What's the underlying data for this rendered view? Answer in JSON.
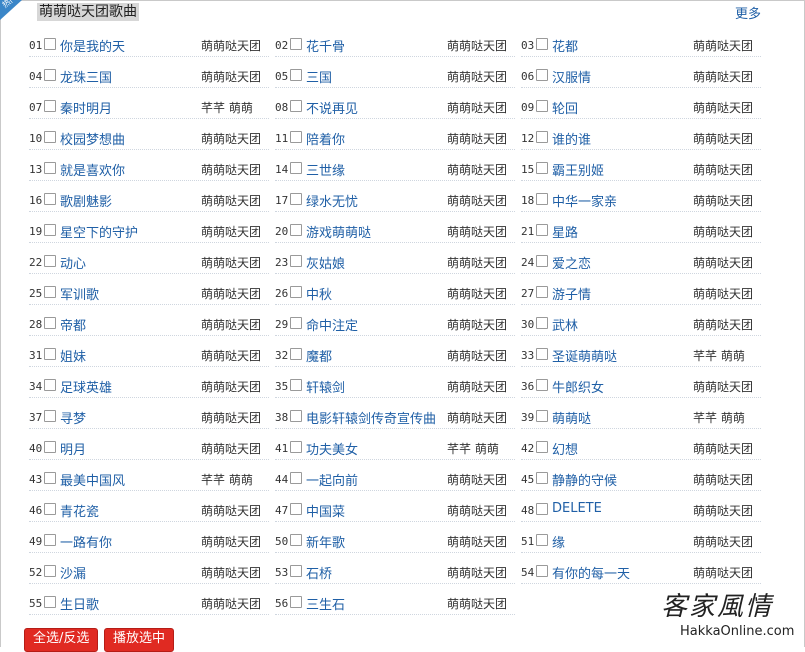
{
  "header": {
    "badge": "热门",
    "title": "萌萌哒天团歌曲",
    "more_label": "更多"
  },
  "songs": [
    {
      "num": "01",
      "name": "你是我的天",
      "artist": "萌萌哒天团"
    },
    {
      "num": "02",
      "name": "花千骨",
      "artist": "萌萌哒天团"
    },
    {
      "num": "03",
      "name": "花都",
      "artist": "萌萌哒天团"
    },
    {
      "num": "04",
      "name": "龙珠三国",
      "artist": "萌萌哒天团"
    },
    {
      "num": "05",
      "name": "三国",
      "artist": "萌萌哒天团"
    },
    {
      "num": "06",
      "name": "汉服情",
      "artist": "萌萌哒天团"
    },
    {
      "num": "07",
      "name": "秦时明月",
      "artist": "芊芊 萌萌"
    },
    {
      "num": "08",
      "name": "不说再见",
      "artist": "萌萌哒天团"
    },
    {
      "num": "09",
      "name": "轮回",
      "artist": "萌萌哒天团"
    },
    {
      "num": "10",
      "name": "校园梦想曲",
      "artist": "萌萌哒天团"
    },
    {
      "num": "11",
      "name": "陪着你",
      "artist": "萌萌哒天团"
    },
    {
      "num": "12",
      "name": "谁的谁",
      "artist": "萌萌哒天团"
    },
    {
      "num": "13",
      "name": "就是喜欢你",
      "artist": "萌萌哒天团"
    },
    {
      "num": "14",
      "name": "三世缘",
      "artist": "萌萌哒天团"
    },
    {
      "num": "15",
      "name": "霸王别姬",
      "artist": "萌萌哒天团"
    },
    {
      "num": "16",
      "name": "歌剧魅影",
      "artist": "萌萌哒天团"
    },
    {
      "num": "17",
      "name": "绿水无忧",
      "artist": "萌萌哒天团"
    },
    {
      "num": "18",
      "name": "中华一家亲",
      "artist": "萌萌哒天团"
    },
    {
      "num": "19",
      "name": "星空下的守护",
      "artist": "萌萌哒天团"
    },
    {
      "num": "20",
      "name": "游戏萌萌哒",
      "artist": "萌萌哒天团"
    },
    {
      "num": "21",
      "name": "星路",
      "artist": "萌萌哒天团"
    },
    {
      "num": "22",
      "name": "动心",
      "artist": "萌萌哒天团"
    },
    {
      "num": "23",
      "name": "灰姑娘",
      "artist": "萌萌哒天团"
    },
    {
      "num": "24",
      "name": "爱之恋",
      "artist": "萌萌哒天团"
    },
    {
      "num": "25",
      "name": "军训歌",
      "artist": "萌萌哒天团"
    },
    {
      "num": "26",
      "name": "中秋",
      "artist": "萌萌哒天团"
    },
    {
      "num": "27",
      "name": "游子情",
      "artist": "萌萌哒天团"
    },
    {
      "num": "28",
      "name": "帝都",
      "artist": "萌萌哒天团"
    },
    {
      "num": "29",
      "name": "命中注定",
      "artist": "萌萌哒天团"
    },
    {
      "num": "30",
      "name": "武林",
      "artist": "萌萌哒天团"
    },
    {
      "num": "31",
      "name": "姐妹",
      "artist": "萌萌哒天团"
    },
    {
      "num": "32",
      "name": "魔都",
      "artist": "萌萌哒天团"
    },
    {
      "num": "33",
      "name": "圣诞萌萌哒",
      "artist": "芊芊 萌萌"
    },
    {
      "num": "34",
      "name": "足球英雄",
      "artist": "萌萌哒天团"
    },
    {
      "num": "35",
      "name": "轩辕剑",
      "artist": "萌萌哒天团"
    },
    {
      "num": "36",
      "name": "牛郎织女",
      "artist": "萌萌哒天团"
    },
    {
      "num": "37",
      "name": "寻梦",
      "artist": "萌萌哒天团"
    },
    {
      "num": "38",
      "name": "电影轩辕剑传奇宣传曲",
      "artist": "萌萌哒天团"
    },
    {
      "num": "39",
      "name": "萌萌哒",
      "artist": "芊芊 萌萌"
    },
    {
      "num": "40",
      "name": "明月",
      "artist": "萌萌哒天团"
    },
    {
      "num": "41",
      "name": "功夫美女",
      "artist": "芊芊 萌萌"
    },
    {
      "num": "42",
      "name": "幻想",
      "artist": "萌萌哒天团"
    },
    {
      "num": "43",
      "name": "最美中国风",
      "artist": "芊芊 萌萌"
    },
    {
      "num": "44",
      "name": "一起向前",
      "artist": "萌萌哒天团"
    },
    {
      "num": "45",
      "name": "静静的守候",
      "artist": "萌萌哒天团"
    },
    {
      "num": "46",
      "name": "青花瓷",
      "artist": "萌萌哒天团"
    },
    {
      "num": "47",
      "name": "中国菜",
      "artist": "萌萌哒天团"
    },
    {
      "num": "48",
      "name": "DELETE",
      "artist": "萌萌哒天团"
    },
    {
      "num": "49",
      "name": "一路有你",
      "artist": "萌萌哒天团"
    },
    {
      "num": "50",
      "name": "新年歌",
      "artist": "萌萌哒天团"
    },
    {
      "num": "51",
      "name": "缘",
      "artist": "萌萌哒天团"
    },
    {
      "num": "52",
      "name": "沙漏",
      "artist": "萌萌哒天团"
    },
    {
      "num": "53",
      "name": "石桥",
      "artist": "萌萌哒天团"
    },
    {
      "num": "54",
      "name": "有你的每一天",
      "artist": "萌萌哒天团"
    },
    {
      "num": "55",
      "name": "生日歌",
      "artist": "萌萌哒天团"
    },
    {
      "num": "56",
      "name": "三生石",
      "artist": "萌萌哒天团"
    }
  ],
  "actions": {
    "select_all_label": "全选/反选",
    "play_selected_label": "播放选中"
  },
  "watermark": {
    "logo_text": "客家風情",
    "url": "HakkaOnline.com"
  },
  "colors": {
    "link": "#1f5fa6",
    "button": "#e02a22",
    "badge": "#3a86c8"
  }
}
